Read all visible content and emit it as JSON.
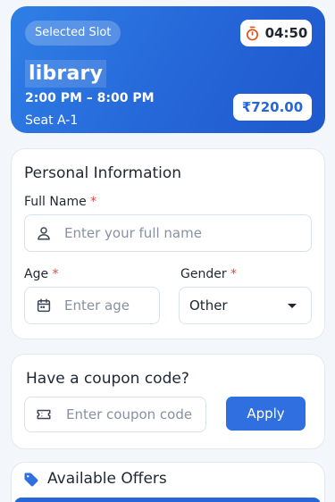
{
  "slot": {
    "pill_label": "Selected Slot",
    "timer": "04:50",
    "venue": "library",
    "time_range": "2:00 PM – 8:00 PM",
    "seat": "Seat A-1",
    "price": "₹720.00"
  },
  "personal": {
    "title": "Personal Information",
    "full_name_label": "Full Name",
    "full_name_placeholder": "Enter your full name",
    "age_label": "Age",
    "age_placeholder": "Enter age",
    "gender_label": "Gender",
    "gender_value": "Other",
    "required_mark": "*"
  },
  "coupon": {
    "title": "Have a coupon code?",
    "placeholder": "Enter coupon code",
    "apply_label": "Apply"
  },
  "offers": {
    "title": "Available Offers"
  },
  "colors": {
    "primary": "#2566d8",
    "required": "#e5483e",
    "timer_icon": "#e0531f"
  },
  "icons": [
    "timer-icon",
    "person-icon",
    "calendar-icon",
    "ticket-icon",
    "tag-icon",
    "chevron-down-icon"
  ]
}
